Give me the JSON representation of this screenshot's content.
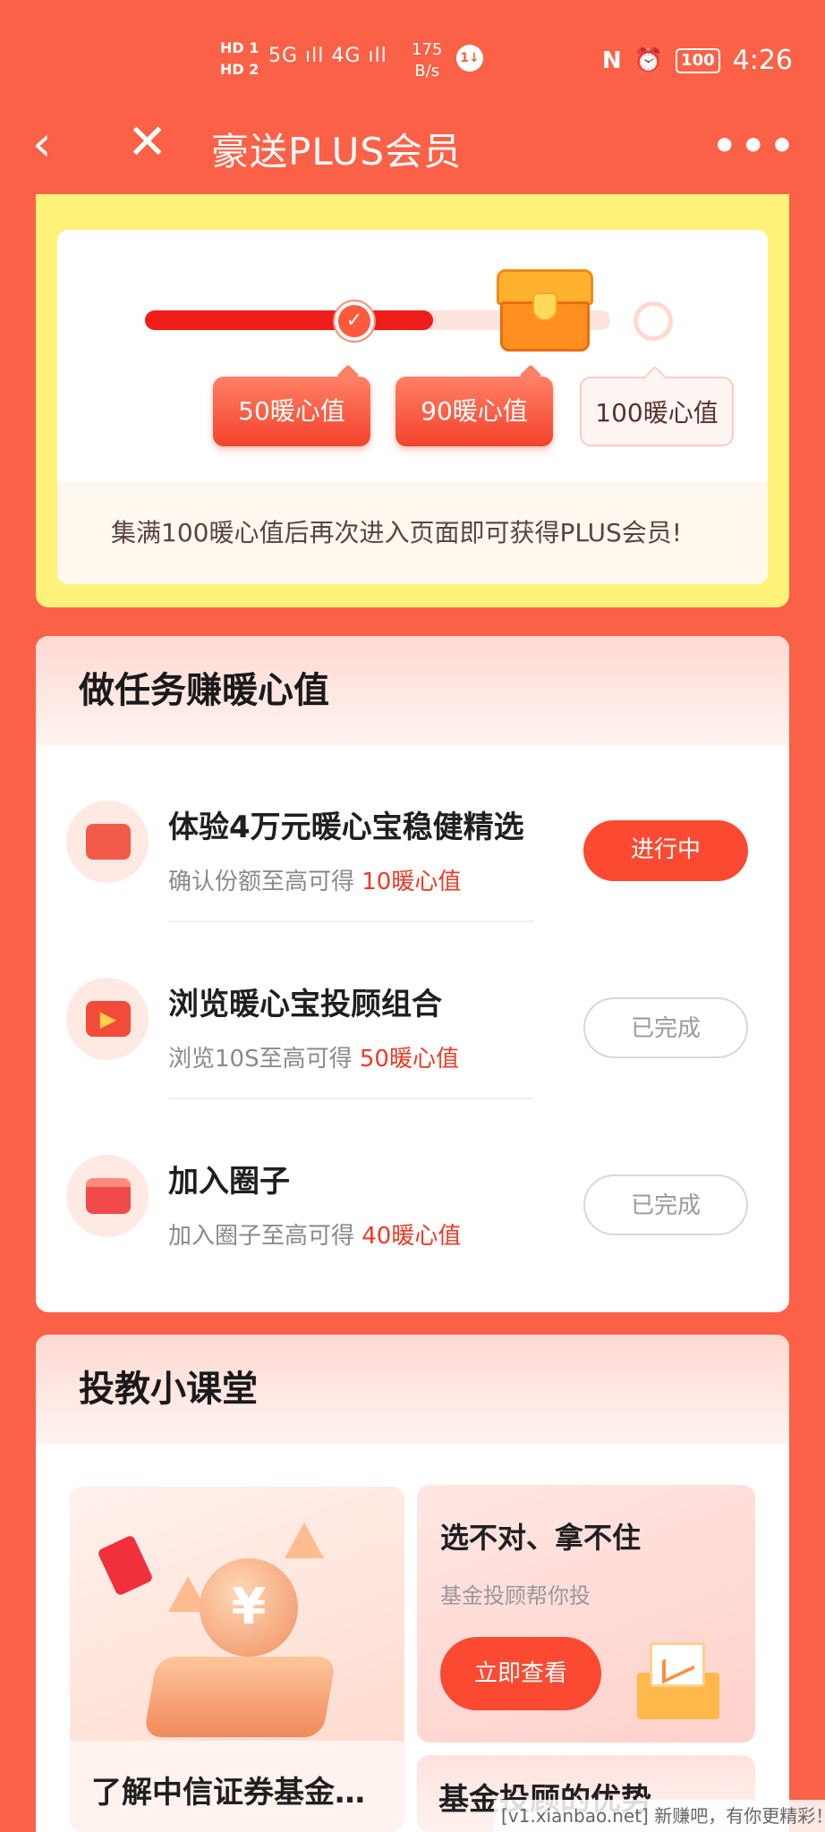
{
  "status_bar": {
    "hd_labels": "HD 1\nHD 2",
    "signal": "5G ıll 4G ıll",
    "speed": "175\nB/s",
    "badge": "1↓",
    "nfc": "N",
    "alarm": "⏰",
    "battery": "100",
    "time": "4:26"
  },
  "nav": {
    "title": "豪送PLUS会员",
    "back_icon": "chevron-left",
    "close_icon": "close",
    "more_icon": "more-horizontal"
  },
  "progress": {
    "fill_fraction": 0.62,
    "milestones": [
      {
        "label": "50暖心值",
        "done": true
      },
      {
        "label": "90暖心值",
        "done": true
      },
      {
        "label": "100暖心值",
        "done": false
      }
    ],
    "note": "集满100暖心值后再次进入页面即可获得PLUS会员!"
  },
  "tasks": {
    "heading": "做任务赚暖心值",
    "items": [
      {
        "title": "体验4万元暖心宝稳健精选",
        "sub_prefix": "确认份额至高可得 ",
        "sub_value": "10暖心值",
        "button": "进行中",
        "icon": "wallet-icon"
      },
      {
        "title": "浏览暖心宝投顾组合",
        "sub_prefix": "浏览10S至高可得 ",
        "sub_value": "50暖心值",
        "button": "已完成",
        "icon": "video-play-icon"
      },
      {
        "title": "加入圈子",
        "sub_prefix": "加入圈子至高可得 ",
        "sub_value": "40暖心值",
        "button": "已完成",
        "icon": "gift-box-icon"
      }
    ]
  },
  "lessons": {
    "heading": "投教小课堂",
    "card1_caption": "了解中信证券基金…",
    "coin_symbol": "¥",
    "card2_title": "选不对、拿不住",
    "card2_sub": "基金投顾帮你投",
    "card2_button": "立即查看",
    "card3_caption": "基金投顾的优势"
  },
  "watermark": "[v1.xianbao.net] 新赚吧，有你更精彩！",
  "colors": {
    "brand": "#fb6146",
    "accent_red": "#fb4a31",
    "highlight_yellow": "#fff27a"
  }
}
